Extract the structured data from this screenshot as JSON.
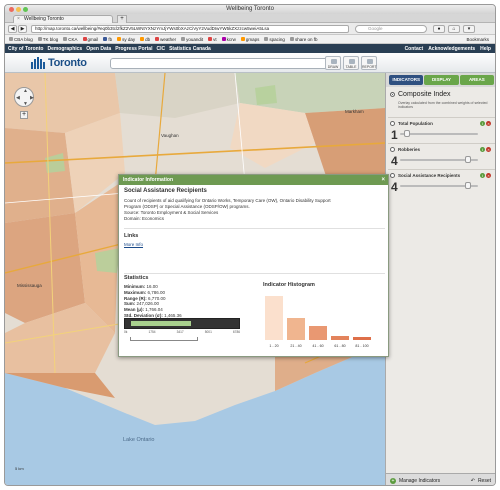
{
  "window": {
    "title": "Wellbeing Toronto"
  },
  "tabs": [
    {
      "label": "Wellbeing Toronto"
    }
  ],
  "address": {
    "url": "http://map.toronto.ca/wellbeing/#eq0b3tcl2fkZ2V5LWNtYXNzYmJjYWs0bXAzCiVyY2VudDIwYW5kZXzzcw5weiA5Lsa",
    "search_placeholder": "Google"
  },
  "bookmarks": [
    "CBA blog",
    "TK blog",
    "CKA",
    "gmail",
    "fb",
    "sy day",
    "db",
    "weather",
    "youandit",
    "vt",
    "kcrw",
    "gmaps",
    "spacing",
    "share on fb"
  ],
  "bookmarks_right": "Bookmarks",
  "site_nav": {
    "left": [
      "City of Toronto",
      "Demographics",
      "Open Data",
      "Progress Portal",
      "CIC",
      "Statistics Canada"
    ],
    "right": [
      "Contact",
      "Acknowledgements",
      "Help"
    ]
  },
  "brand": {
    "logo": "Toronto"
  },
  "toolbar": {
    "draw": "DRAW",
    "table": "TABLE",
    "report": "REPORT"
  },
  "map": {
    "labels": [
      "Vaughan",
      "Markham",
      "Mississauga"
    ],
    "lake": "Lake Ontario",
    "scale": "5 km"
  },
  "panel": {
    "tabs": [
      "INDICATORS",
      "DISPLAY",
      "AREAS"
    ],
    "composite": {
      "title": "Composite Index",
      "subtitle": "Overlay calculated from the combined weights of selected indicators"
    },
    "indicators": [
      {
        "label": "Total Population",
        "weight": "1",
        "slider": 0.05
      },
      {
        "label": "Robberies",
        "weight": "4",
        "slider": 0.9
      },
      {
        "label": "Social Assistance Recipients",
        "weight": "4",
        "slider": 0.9
      }
    ],
    "footer": {
      "manage": "Manage Indicators",
      "reset": "Reset"
    }
  },
  "popup": {
    "title": "Indicator Information",
    "name": "Social Assistance Recipients",
    "description": "Count of recipients of aid qualifying for Ontario Works, Temporary Care (OW), Ontario Disability Support Program (ODSP) or Special Assistance (ODSP/OW) programs.",
    "source": "Source: Toronto Employment & Social Services",
    "domain": "Domain: Economics",
    "links_heading": "Links",
    "more_info": "More Info",
    "stats_heading": "Statistics",
    "stats": [
      {
        "k": "Minimum:",
        "v": "16.00"
      },
      {
        "k": "Maximum:",
        "v": "6,786.00"
      },
      {
        "k": "Range (R):",
        "v": "6,770.00"
      },
      {
        "k": "Sum:",
        "v": "247,026.00"
      },
      {
        "k": "Mean (μ):",
        "v": "1,766.04"
      },
      {
        "k": "Std. Deviation (σ):",
        "v": "1,465.36"
      }
    ],
    "axis_ticks": [
      "0k",
      "1754",
      "3417",
      "5001",
      "6786"
    ],
    "histogram_title": "Indicator Histogram",
    "histogram": [
      {
        "label": "1 - 20",
        "height": 1.0
      },
      {
        "label": "21 - 40",
        "height": 0.49
      },
      {
        "label": "41 - 60",
        "height": 0.31
      },
      {
        "label": "61 - 80",
        "height": 0.1
      },
      {
        "label": "81 - 100",
        "height": 0.06
      }
    ]
  },
  "colors": {
    "accent_green": "#6aa64a",
    "header_blue": "#2a3f54"
  }
}
